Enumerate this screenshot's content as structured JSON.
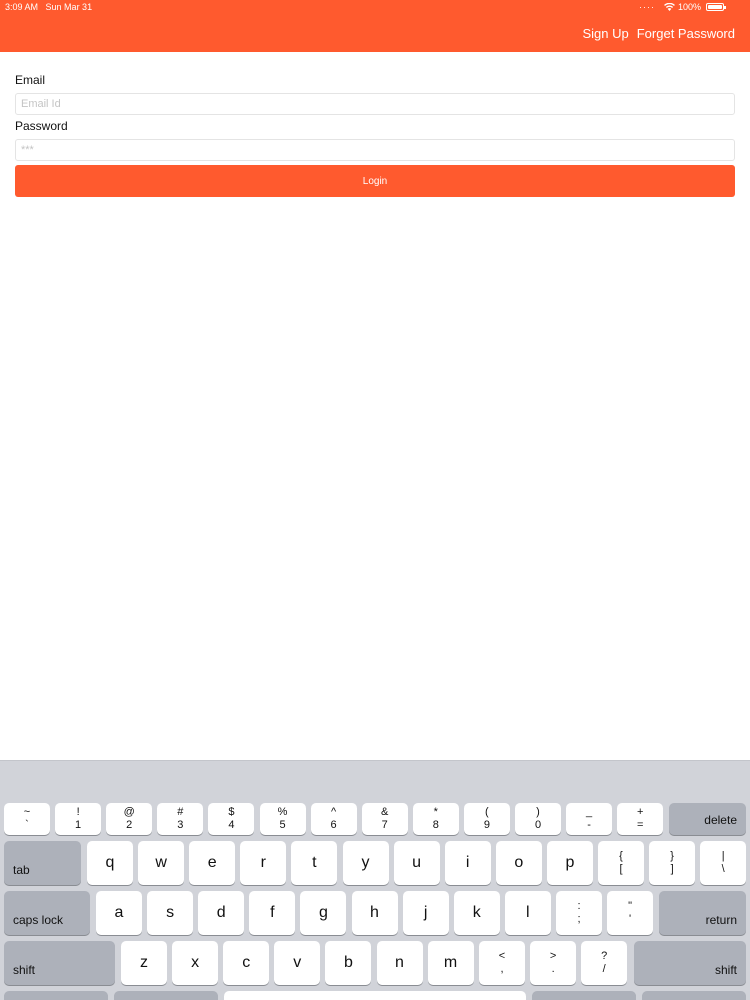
{
  "status": {
    "time": "3:09 AM",
    "date": "Sun Mar 31",
    "battery": "100%"
  },
  "nav": {
    "sign_up": "Sign Up",
    "forget_password": "Forget Password"
  },
  "form": {
    "email_label": "Email",
    "email_placeholder": "Email Id",
    "password_label": "Password",
    "password_placeholder": "***",
    "login_label": "Login"
  },
  "keyboard": {
    "number_row": [
      {
        "top": "~",
        "bottom": "`"
      },
      {
        "top": "!",
        "bottom": "1"
      },
      {
        "top": "@",
        "bottom": "2"
      },
      {
        "top": "#",
        "bottom": "3"
      },
      {
        "top": "$",
        "bottom": "4"
      },
      {
        "top": "%",
        "bottom": "5"
      },
      {
        "top": "^",
        "bottom": "6"
      },
      {
        "top": "&",
        "bottom": "7"
      },
      {
        "top": "*",
        "bottom": "8"
      },
      {
        "top": "(",
        "bottom": "9"
      },
      {
        "top": ")",
        "bottom": "0"
      },
      {
        "top": "_",
        "bottom": "-"
      },
      {
        "top": "+",
        "bottom": "="
      }
    ],
    "delete": "delete",
    "tab": "tab",
    "row_q": [
      "q",
      "w",
      "e",
      "r",
      "t",
      "y",
      "u",
      "i",
      "o",
      "p"
    ],
    "row_q_symbols": [
      {
        "top": "{",
        "bottom": "["
      },
      {
        "top": "}",
        "bottom": "]"
      },
      {
        "top": "|",
        "bottom": "\\"
      }
    ],
    "caps_lock": "caps lock",
    "row_a": [
      "a",
      "s",
      "d",
      "f",
      "g",
      "h",
      "j",
      "k",
      "l"
    ],
    "row_a_symbols": [
      {
        "top": ":",
        "bottom": ";"
      },
      {
        "top": "\"",
        "bottom": "'"
      }
    ],
    "return": "return",
    "shift_left": "shift",
    "row_z": [
      "z",
      "x",
      "c",
      "v",
      "b",
      "n",
      "m"
    ],
    "row_z_symbols": [
      {
        "top": "<",
        "bottom": ","
      },
      {
        "top": ">",
        "bottom": "."
      },
      {
        "top": "?",
        "bottom": "/"
      }
    ],
    "shift_right": "shift"
  }
}
